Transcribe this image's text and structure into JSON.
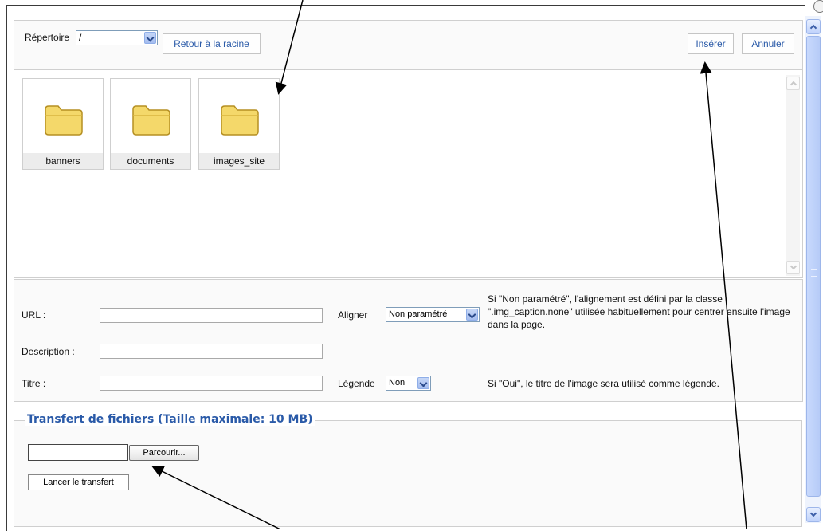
{
  "toolbar": {
    "directory_label": "Répertoire",
    "directory_value": "/",
    "root_button": "Retour à la racine",
    "insert_button": "Insérer",
    "cancel_button": "Annuler"
  },
  "folders": [
    {
      "name": "banners"
    },
    {
      "name": "documents"
    },
    {
      "name": "images_site"
    }
  ],
  "properties": {
    "url_label": "URL :",
    "url_value": "",
    "align_label": "Aligner",
    "align_value": "Non paramétré",
    "align_note": "Si \"Non paramétré\", l'alignement est défini par la classe \".img_caption.none\" utilisée habituellement pour centrer ensuite l'image dans la page.",
    "description_label": "Description :",
    "description_value": "",
    "title_label": "Titre :",
    "title_value": "",
    "caption_label": "Légende",
    "caption_value": "Non",
    "caption_note": "Si \"Oui\", le titre de l'image sera utilisé comme légende."
  },
  "upload": {
    "legend": "Transfert de fichiers (Taille maximale: 10 MB)",
    "file_value": "",
    "browse_button": "Parcourir...",
    "start_button": "Lancer le transfert"
  },
  "colors": {
    "accent": "#2a5aa8",
    "panel_bg": "#fafafa",
    "border": "#cfcfcf"
  }
}
